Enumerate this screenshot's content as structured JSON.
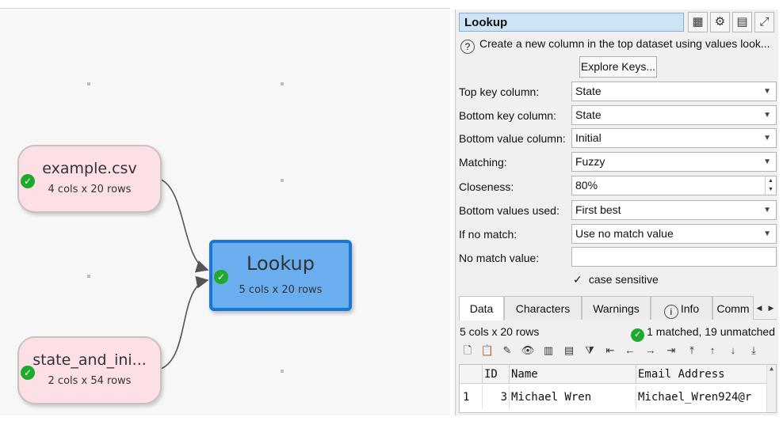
{
  "canvas": {
    "nodes": [
      {
        "name": "example.csv",
        "info": "4 cols x 20 rows"
      },
      {
        "name": "state_and_ini...",
        "info": "2 cols x 54 rows"
      },
      {
        "name": "Lookup",
        "info": "5 cols x 20 rows"
      }
    ],
    "status_icon": "check-icon"
  },
  "panel": {
    "title": "Lookup",
    "toolbar_icons": [
      "calculator-icon",
      "gear-icon",
      "table-icon",
      "fullscreen-icon"
    ],
    "description": "Create a new column in the top dataset using values look...",
    "explore_button": "Explore Keys...",
    "fields": {
      "top_key_label": "Top key column:",
      "top_key_value": "State",
      "bottom_key_label": "Bottom key column:",
      "bottom_key_value": "State",
      "bottom_value_label": "Bottom value column:",
      "bottom_value_value": "Initial",
      "matching_label": "Matching:",
      "matching_value": "Fuzzy",
      "closeness_label": "Closeness:",
      "closeness_value": "80%",
      "values_used_label": "Bottom values used:",
      "values_used_value": "First best",
      "no_match_label": "If no match:",
      "no_match_value": "Use no match value",
      "no_match_value_label": "No match value:",
      "no_match_value_value": ""
    },
    "case_sensitive": {
      "label": "case sensitive",
      "checked": true,
      "mark": "✓"
    },
    "tabs": [
      "Data",
      "Characters",
      "Warnings",
      "Info",
      "Comm"
    ],
    "active_tab": "Data",
    "status_left": "5 cols x 20 rows",
    "status_right": "1 matched, 19 unmatched",
    "grid": {
      "columns": [
        "ID",
        "Name",
        "Email Address"
      ],
      "rows": [
        {
          "row": "1",
          "id": "3",
          "name": "Michael Wren",
          "email": "Michael_Wren924@r"
        }
      ]
    }
  }
}
